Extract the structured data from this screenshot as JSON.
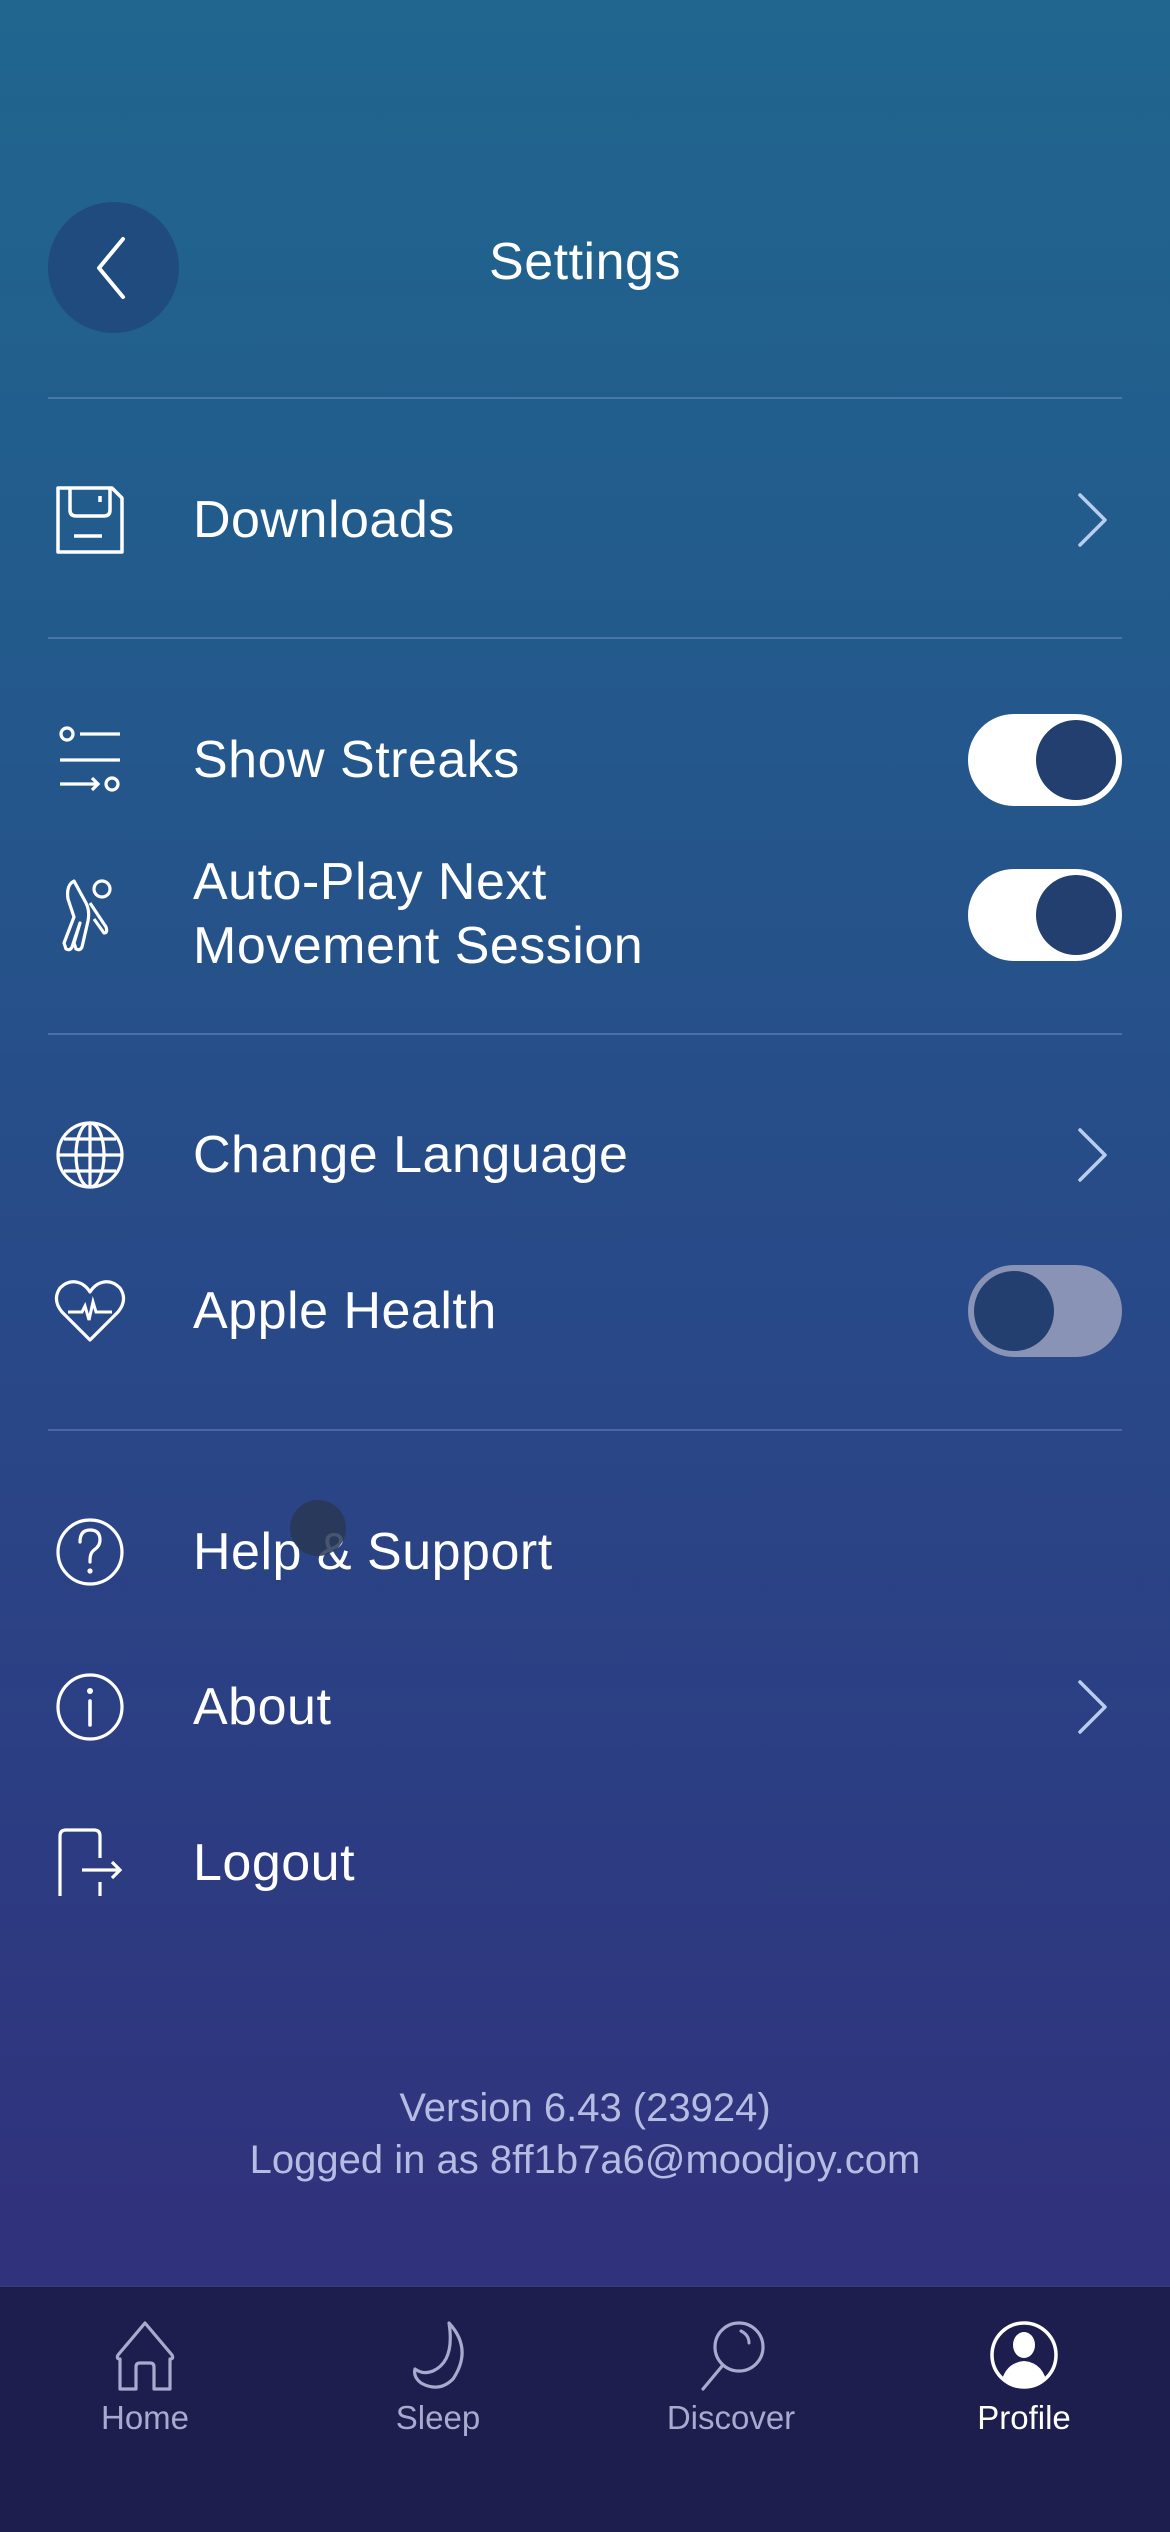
{
  "header": {
    "title": "Settings",
    "back_icon": "chevron-left-icon"
  },
  "sections": [
    {
      "items": [
        {
          "id": "downloads",
          "label": "Downloads",
          "icon": "floppy-disk-icon",
          "control": "chevron"
        }
      ]
    },
    {
      "items": [
        {
          "id": "show-streaks",
          "label": "Show Streaks",
          "icon": "sliders-icon",
          "control": "toggle",
          "value": true
        },
        {
          "id": "auto-play",
          "label_line1": "Auto-Play Next",
          "label_line2": "Movement Session",
          "icon": "movement-figure-icon",
          "control": "toggle",
          "value": true
        }
      ]
    },
    {
      "items": [
        {
          "id": "change-language",
          "label": "Change Language",
          "icon": "globe-icon",
          "control": "chevron"
        },
        {
          "id": "apple-health",
          "label": "Apple Health",
          "icon": "heart-pulse-icon",
          "control": "toggle",
          "value": false
        }
      ]
    },
    {
      "items": [
        {
          "id": "help-support",
          "label": "Help & Support",
          "icon": "question-circle-icon",
          "control": "none"
        },
        {
          "id": "about",
          "label": "About",
          "icon": "info-circle-icon",
          "control": "chevron"
        },
        {
          "id": "logout",
          "label": "Logout",
          "icon": "logout-icon",
          "control": "none"
        }
      ]
    }
  ],
  "footer": {
    "version": "Version 6.43 (23924)",
    "logged_in": "Logged in as 8ff1b7a6@moodjoy.com"
  },
  "tabbar": {
    "tabs": [
      {
        "label": "Home",
        "icon": "home-icon",
        "active": false
      },
      {
        "label": "Sleep",
        "icon": "moon-icon",
        "active": false
      },
      {
        "label": "Discover",
        "icon": "magnifier-icon",
        "active": false
      },
      {
        "label": "Profile",
        "icon": "profile-icon",
        "active": true
      }
    ]
  },
  "colors": {
    "gradient_top": "#20668f",
    "gradient_bottom": "#30307a",
    "tabbar_bg": "#1e1e4e",
    "toggle_on_track": "#ffffff",
    "toggle_off_track": "#8893b6",
    "toggle_knob": "#223f70",
    "tab_inactive": "#a7abcf",
    "tab_active": "#ffffff"
  }
}
